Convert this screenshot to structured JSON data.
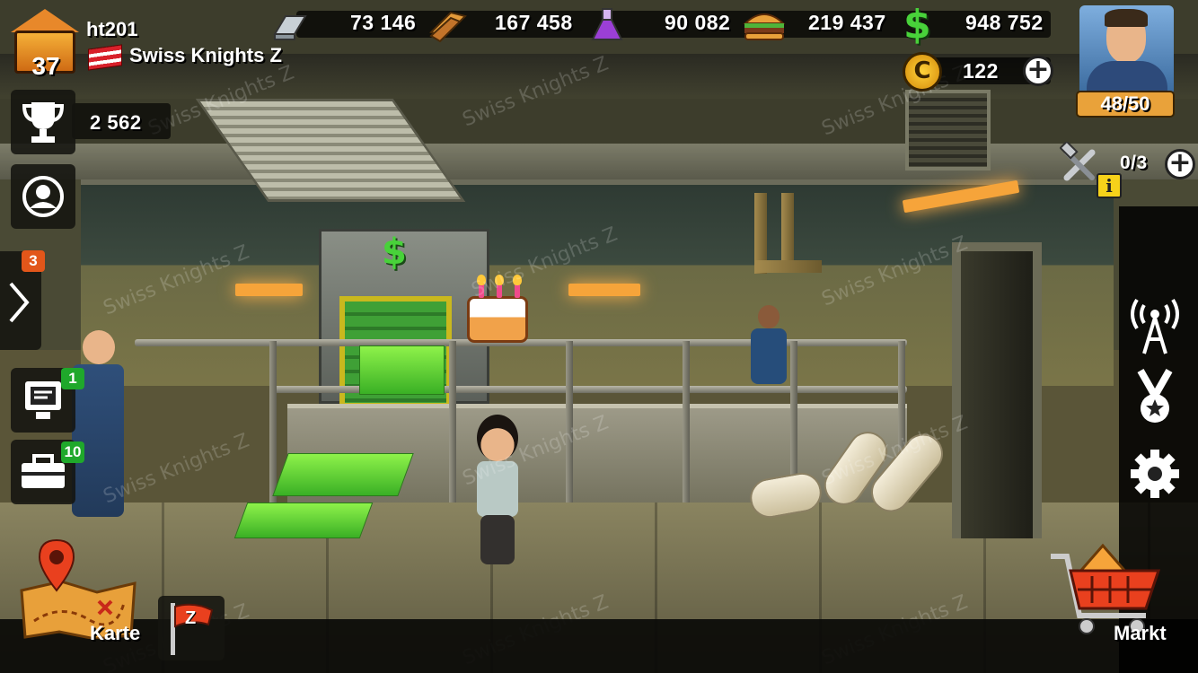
{
  "player": {
    "level": "37",
    "name": "ht201",
    "clan": "Swiss Knights Z",
    "trophies": "2 562"
  },
  "resources": {
    "steel": "73 146",
    "wood": "167 458",
    "chemicals": "90 082",
    "food": "219 437",
    "money": "948 752",
    "coins": "122"
  },
  "population": "48/50",
  "builders": "0/3",
  "badges": {
    "expand_panel": "3",
    "computer": "1",
    "toolbox": "10"
  },
  "bottom": {
    "map_label": "Karte",
    "market_label": "Markt",
    "clan_flag_letter": "Z"
  },
  "watermark": "Swiss Knights Z",
  "colors": {
    "money_green": "#48d23a",
    "level_orange": "#e8882a",
    "badge_green": "#1fa82b",
    "badge_orange": "#e2561a",
    "market_red": "#e9401e"
  },
  "icons": {
    "steel": "steel-ingot-icon",
    "wood": "wood-planks-icon",
    "chemicals": "potion-flask-icon",
    "food": "burger-icon",
    "money": "dollar-icon",
    "coins": "coin-icon",
    "builders": "hammer-wrench-icon",
    "info": "info-icon",
    "radio": "radio-tower-icon",
    "medal": "medal-icon",
    "settings": "gear-icon",
    "trophy": "trophy-icon",
    "profile": "profile-icon",
    "map": "map-pin-icon",
    "market": "shopping-cart-icon"
  }
}
